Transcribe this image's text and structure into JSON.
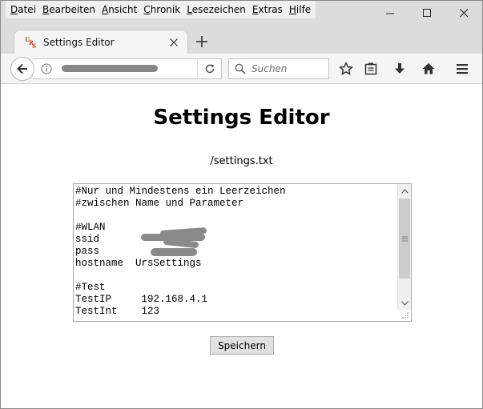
{
  "window": {
    "menu": [
      "Datei",
      "Bearbeiten",
      "Ansicht",
      "Chronik",
      "Lesezeichen",
      "Extras",
      "Hilfe"
    ],
    "controls": {
      "minimize": "—",
      "maximize": "☐",
      "close": "✕"
    }
  },
  "tab": {
    "favicon_text": "URS",
    "title": "Settings Editor",
    "close_label": "×",
    "new_tab_label": "+"
  },
  "navbar": {
    "url": "",
    "search_placeholder": "Suchen"
  },
  "page": {
    "title": "Settings Editor",
    "subtitle": "/settings.txt",
    "editor_text": "#Nur und Mindestens ein Leerzeichen\n#zwischen Name und Parameter\n\n#WLAN\nssid\npass\nhostname  UrsSettings\n\n#Test\nTestIP     192.168.4.1\nTestInt    123",
    "save_label": "Speichern"
  },
  "colors": {
    "chrome_bg": "#dcdcdc",
    "toolbar_bg": "#f5f5f5",
    "button_bg": "#e1e1e1",
    "favicon_red": "#c0392b",
    "redaction": "#888888"
  },
  "icons": {
    "back": "back-arrow-icon",
    "info": "info-icon",
    "reload": "reload-icon",
    "search": "search-icon",
    "bookmark": "star-icon",
    "library": "clipboard-icon",
    "downloads": "download-arrow-icon",
    "home": "home-icon",
    "menu": "hamburger-menu-icon"
  }
}
